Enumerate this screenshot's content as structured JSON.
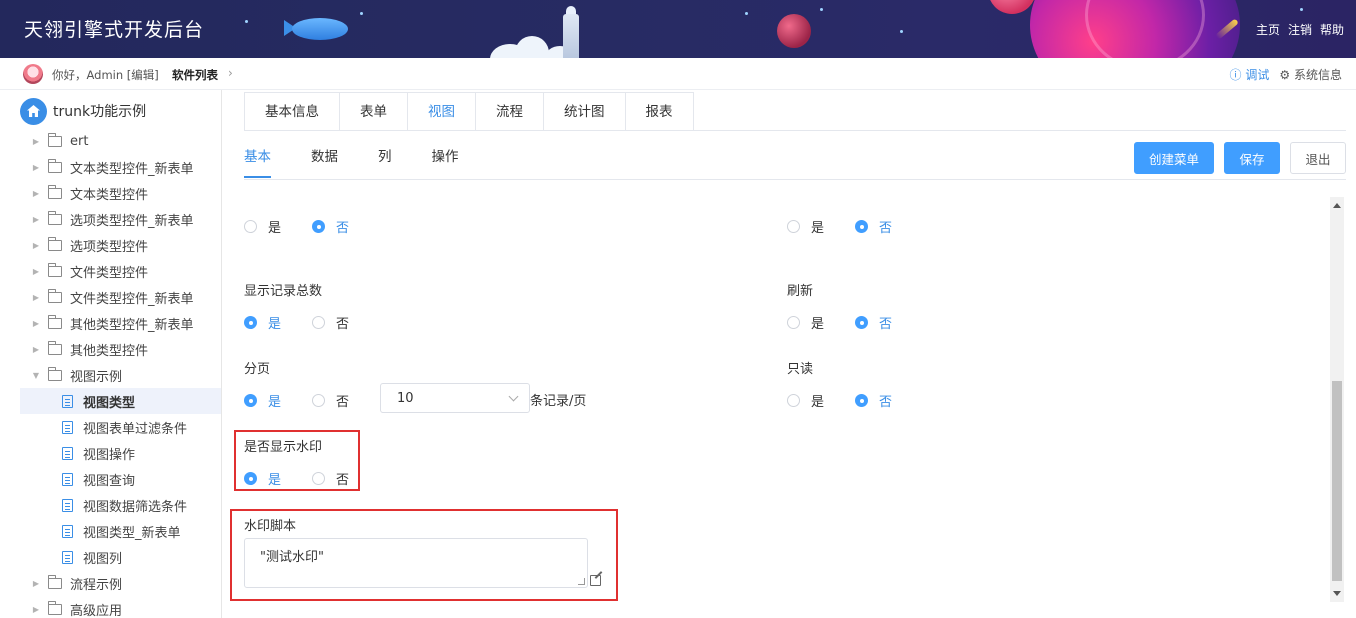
{
  "header": {
    "title": "天翎引擎式开发后台",
    "links": [
      "主页",
      "注销",
      "帮助"
    ]
  },
  "subbar": {
    "greeting": "你好，Admin [编辑]",
    "breadcrumb": "软件列表",
    "debug": "调试",
    "sysinfo": "系统信息"
  },
  "sidebar": {
    "root": "trunk功能示例",
    "items": [
      {
        "label": "ert",
        "type": "folder"
      },
      {
        "label": "文本类型控件_新表单",
        "type": "folder"
      },
      {
        "label": "文本类型控件",
        "type": "folder"
      },
      {
        "label": "选项类型控件_新表单",
        "type": "folder"
      },
      {
        "label": "选项类型控件",
        "type": "folder"
      },
      {
        "label": "文件类型控件",
        "type": "folder"
      },
      {
        "label": "文件类型控件_新表单",
        "type": "folder"
      },
      {
        "label": "其他类型控件_新表单",
        "type": "folder"
      },
      {
        "label": "其他类型控件",
        "type": "folder"
      },
      {
        "label": "视图示例",
        "type": "folder-open"
      },
      {
        "label": "视图类型",
        "type": "doc",
        "active": true
      },
      {
        "label": "视图表单过滤条件",
        "type": "doc"
      },
      {
        "label": "视图操作",
        "type": "doc"
      },
      {
        "label": "视图查询",
        "type": "doc"
      },
      {
        "label": "视图数据筛选条件",
        "type": "doc"
      },
      {
        "label": "视图类型_新表单",
        "type": "doc"
      },
      {
        "label": "视图列",
        "type": "doc"
      },
      {
        "label": "流程示例",
        "type": "folder"
      },
      {
        "label": "高级应用",
        "type": "folder"
      }
    ]
  },
  "tabs": [
    "基本信息",
    "表单",
    "视图",
    "流程",
    "统计图",
    "报表"
  ],
  "active_tab": "视图",
  "subtabs": [
    "基本",
    "数据",
    "列",
    "操作"
  ],
  "buttons": {
    "create_menu": "创建菜单",
    "save": "保存",
    "exit": "退出"
  },
  "form": {
    "yes": "是",
    "no": "否",
    "show_total": "显示记录总数",
    "refresh": "刷新",
    "paging": "分页",
    "readonly": "只读",
    "page_size": "10",
    "page_suffix": "条记录/页",
    "watermark": "是否显示水印",
    "watermark_script": "水印脚本",
    "watermark_script_value": "\"测试水印\""
  },
  "colors": {
    "accent": "#409eff",
    "highlight_border": "#e03030",
    "header_bg": "#23285c"
  }
}
